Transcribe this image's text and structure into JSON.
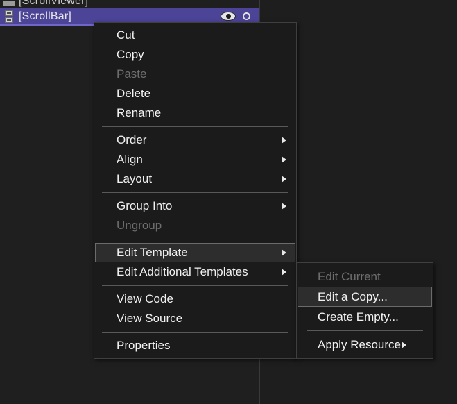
{
  "tree": {
    "rows": [
      {
        "label": "[ScrollViewer]",
        "icon": "scrollviewer-icon",
        "selected": false,
        "partial": true
      },
      {
        "label": "[ScrollBar]",
        "icon": "scrollbar-icon",
        "selected": true,
        "partial": false,
        "actions": [
          {
            "name": "visibility-eye-icon",
            "glyph": "eye"
          },
          {
            "name": "lock-circle-icon",
            "glyph": "circle"
          }
        ]
      }
    ]
  },
  "context_menu": {
    "name": "element-context-menu",
    "items": [
      {
        "label": "Cut",
        "type": "item",
        "disabled": false,
        "submenu": false
      },
      {
        "label": "Copy",
        "type": "item",
        "disabled": false,
        "submenu": false
      },
      {
        "label": "Paste",
        "type": "item",
        "disabled": true,
        "submenu": false
      },
      {
        "label": "Delete",
        "type": "item",
        "disabled": false,
        "submenu": false
      },
      {
        "label": "Rename",
        "type": "item",
        "disabled": false,
        "submenu": false
      },
      {
        "type": "separator"
      },
      {
        "label": "Order",
        "type": "item",
        "disabled": false,
        "submenu": true
      },
      {
        "label": "Align",
        "type": "item",
        "disabled": false,
        "submenu": true
      },
      {
        "label": "Layout",
        "type": "item",
        "disabled": false,
        "submenu": true
      },
      {
        "type": "separator"
      },
      {
        "label": "Group Into",
        "type": "item",
        "disabled": false,
        "submenu": true
      },
      {
        "label": "Ungroup",
        "type": "item",
        "disabled": true,
        "submenu": false
      },
      {
        "type": "separator"
      },
      {
        "label": "Edit Template",
        "type": "item",
        "disabled": false,
        "submenu": true,
        "highlighted": true
      },
      {
        "label": "Edit Additional Templates",
        "type": "item",
        "disabled": false,
        "submenu": true
      },
      {
        "type": "separator"
      },
      {
        "label": "View Code",
        "type": "item",
        "disabled": false,
        "submenu": false
      },
      {
        "label": "View Source",
        "type": "item",
        "disabled": false,
        "submenu": false
      },
      {
        "type": "separator"
      },
      {
        "label": "Properties",
        "type": "item",
        "disabled": false,
        "submenu": false
      }
    ]
  },
  "submenu": {
    "name": "edit-template-submenu",
    "items": [
      {
        "label": "Edit Current",
        "type": "item",
        "disabled": true,
        "submenu": false
      },
      {
        "label": "Edit a Copy...",
        "type": "item",
        "disabled": false,
        "submenu": false,
        "highlighted": true
      },
      {
        "label": "Create Empty...",
        "type": "item",
        "disabled": false,
        "submenu": false
      },
      {
        "type": "separator"
      },
      {
        "label": "Apply Resource",
        "type": "item",
        "disabled": false,
        "submenu": true
      }
    ]
  },
  "colors": {
    "selection": "#4c4496",
    "selection_border": "#6f66c8",
    "menu_bg": "#1b1b1b",
    "menu_border": "#3f3f3f",
    "highlight_bg": "#2d2d2d",
    "highlight_border": "#6b6b6b",
    "text": "#f2f2f2",
    "text_disabled": "#6e6e6e",
    "panel_bg": "#1f1f1f"
  }
}
